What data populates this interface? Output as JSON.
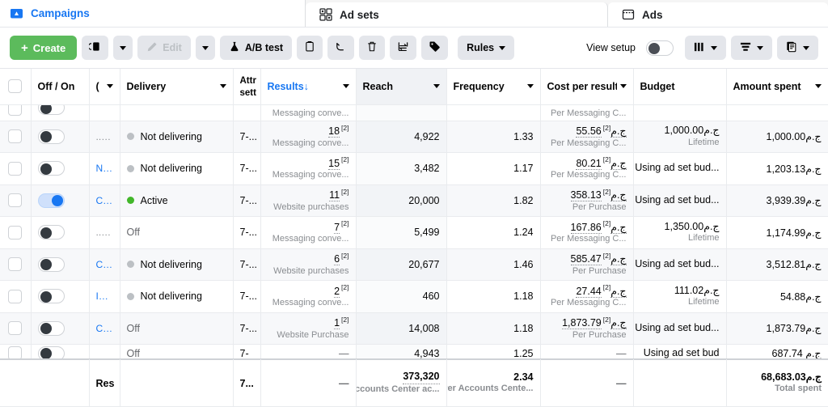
{
  "tabs": [
    {
      "label": "Campaigns",
      "icon": "campaign-folder-icon",
      "active": true
    },
    {
      "label": "Ad sets",
      "icon": "adsets-grid-icon",
      "active": false
    },
    {
      "label": "Ads",
      "icon": "ads-window-icon",
      "active": false
    }
  ],
  "toolbar": {
    "create_label": "Create",
    "duplicate_icon": "duplicate-icon",
    "duplicate_caret_icon": "chevron-down-icon",
    "edit_label": "Edit",
    "edit_icon": "pencil-icon",
    "edit_caret_icon": "chevron-down-icon",
    "abtest_label": "A/B test",
    "abtest_icon": "flask-icon",
    "clipboard_icon": "clipboard-icon",
    "undo_icon": "undo-arrow-icon",
    "delete_icon": "trash-icon",
    "transfer_icon": "transfer-arrows-icon",
    "tag_icon": "tag-icon",
    "rules_label": "Rules",
    "rules_caret_icon": "chevron-down-icon",
    "view_setup_label": "View setup",
    "view_setup_toggle": "off",
    "columns_icon": "columns-icon",
    "columns_caret_icon": "chevron-down-icon",
    "breakdown_icon": "breakdown-icon",
    "breakdown_caret_icon": "chevron-down-icon",
    "reports_icon": "reports-icon",
    "reports_caret_icon": "chevron-down-icon"
  },
  "table": {
    "columns": [
      {
        "key": "select",
        "label": "",
        "sortable": false,
        "highlight": false
      },
      {
        "key": "offon",
        "label": "Off / On",
        "sortable": false,
        "highlight": false
      },
      {
        "key": "name",
        "label": "(",
        "sortable": true,
        "highlight": false
      },
      {
        "key": "delivery",
        "label": "Delivery",
        "sortable": true,
        "highlight": false
      },
      {
        "key": "attr",
        "label": "Attr sett",
        "sortable": false,
        "highlight": false
      },
      {
        "key": "results",
        "label": "Results",
        "sortable": true,
        "highlight": false,
        "sorted": "desc"
      },
      {
        "key": "reach",
        "label": "Reach",
        "sortable": true,
        "highlight": true
      },
      {
        "key": "frequency",
        "label": "Frequency",
        "sortable": true,
        "highlight": false
      },
      {
        "key": "cpr",
        "label": "Cost per result",
        "sortable": true,
        "highlight": false
      },
      {
        "key": "budget",
        "label": "Budget",
        "sortable": false,
        "highlight": false
      },
      {
        "key": "spent",
        "label": "Amount spent",
        "sortable": true,
        "highlight": false
      }
    ],
    "clipped_top_row": {
      "results_sub": "Messaging conve...",
      "cpr_sub": "Per Messaging C..."
    },
    "rows": [
      {
        "toggle": "off",
        "name": ".... ...",
        "name_muted": true,
        "delivery": "Not delivering",
        "delivery_state": "grey",
        "attr": "7-...",
        "results": "18",
        "results_sup": "[2]",
        "results_sub": "Messaging conve...",
        "reach": "4,922",
        "frequency": "1.33",
        "cpr": "55.56ج.م",
        "cpr_sup": "[2]",
        "cpr_sub": "Per Messaging C...",
        "budget": "1,000.00ج.م",
        "budget_sub": "Lifetime",
        "spent": "1,000.00ج.م"
      },
      {
        "toggle": "off",
        "name": "Ne...",
        "name_muted": false,
        "delivery": "Not delivering",
        "delivery_state": "grey",
        "attr": "7-...",
        "results": "15",
        "results_sup": "[2]",
        "results_sub": "Messaging conve...",
        "reach": "3,482",
        "frequency": "1.17",
        "cpr": "80.21ج.م",
        "cpr_sup": "[2]",
        "cpr_sub": "Per Messaging C...",
        "budget": "Using ad set bud...",
        "budget_sub": "",
        "spent": "1,203.13ج.م"
      },
      {
        "toggle": "on",
        "name": "CB...",
        "name_muted": false,
        "delivery": "Active",
        "delivery_state": "green",
        "attr": "7-...",
        "results": "11",
        "results_sup": "[2]",
        "results_sub": "Website purchases",
        "reach": "20,000",
        "frequency": "1.82",
        "cpr": "358.13ج.م",
        "cpr_sup": "[2]",
        "cpr_sub": "Per Purchase",
        "budget": "Using ad set bud...",
        "budget_sub": "",
        "spent": "3,939.39ج.م"
      },
      {
        "toggle": "off",
        "name": "...ل...",
        "name_muted": true,
        "delivery": "Off",
        "delivery_state": "none",
        "attr": "7-...",
        "results": "7",
        "results_sup": "[2]",
        "results_sub": "Messaging conve...",
        "reach": "5,499",
        "frequency": "1.24",
        "cpr": "167.86ج.م",
        "cpr_sup": "[2]",
        "cpr_sub": "Per Messaging C...",
        "budget": "1,350.00ج.م",
        "budget_sub": "Lifetime",
        "spent": "1,174.99ج.م"
      },
      {
        "toggle": "off",
        "name": "Chi...",
        "name_muted": false,
        "delivery": "Not delivering",
        "delivery_state": "grey",
        "attr": "7-...",
        "results": "6",
        "results_sup": "[2]",
        "results_sub": "Website purchases",
        "reach": "20,677",
        "frequency": "1.46",
        "cpr": "585.47ج.م",
        "cpr_sup": "[2]",
        "cpr_sub": "Per Purchase",
        "budget": "Using ad set bud...",
        "budget_sub": "",
        "spent": "3,512.81ج.م"
      },
      {
        "toggle": "off",
        "name": "Ins...",
        "name_muted": false,
        "delivery": "Not delivering",
        "delivery_state": "grey",
        "attr": "7-...",
        "results": "2",
        "results_sup": "[2]",
        "results_sub": "Messaging conve...",
        "reach": "460",
        "frequency": "1.18",
        "cpr": "27.44ج.م",
        "cpr_sup": "[2]",
        "cpr_sub": "Per Messaging C...",
        "budget": "111.02ج.م",
        "budget_sub": "Lifetime",
        "spent": "54.88ج.م"
      },
      {
        "toggle": "off",
        "name": "Chi...",
        "name_muted": false,
        "delivery": "Off",
        "delivery_state": "none",
        "attr": "7-...",
        "results": "1",
        "results_sup": "[2]",
        "results_sub": "Website Purchase",
        "reach": "14,008",
        "frequency": "1.18",
        "cpr": "1,873.79ج.م",
        "cpr_sup": "[2]",
        "cpr_sub": "Per Purchase",
        "budget": "Using ad set bud...",
        "budget_sub": "",
        "spent": "1,873.79ج.م"
      },
      {
        "toggle": "off",
        "name": "",
        "name_muted": true,
        "delivery": "Off",
        "delivery_state": "none",
        "attr": "7-",
        "results": "—",
        "results_sup": "",
        "results_sub": "",
        "reach": "4,943",
        "frequency": "1.25",
        "cpr": "",
        "cpr_sup": "",
        "cpr_sub": "",
        "budget": "Using ad set bud",
        "budget_sub": "",
        "spent": "687.74 ج.م"
      }
    ],
    "summary": {
      "name": "Res",
      "attr": "7...",
      "results": "—",
      "reach": "373,320",
      "reach_sub": "Accounts Center ac...",
      "frequency": "2.34",
      "frequency_sub": "Per Accounts Cente...",
      "cpr": "—",
      "budget": "",
      "spent": "68,683.03ج.م",
      "spent_sub": "Total spent"
    }
  },
  "colors": {
    "brand_blue": "#1877f2",
    "create_green": "#5cbb5c",
    "active_green": "#42b72a",
    "grey_dot": "#bcc0c4"
  }
}
